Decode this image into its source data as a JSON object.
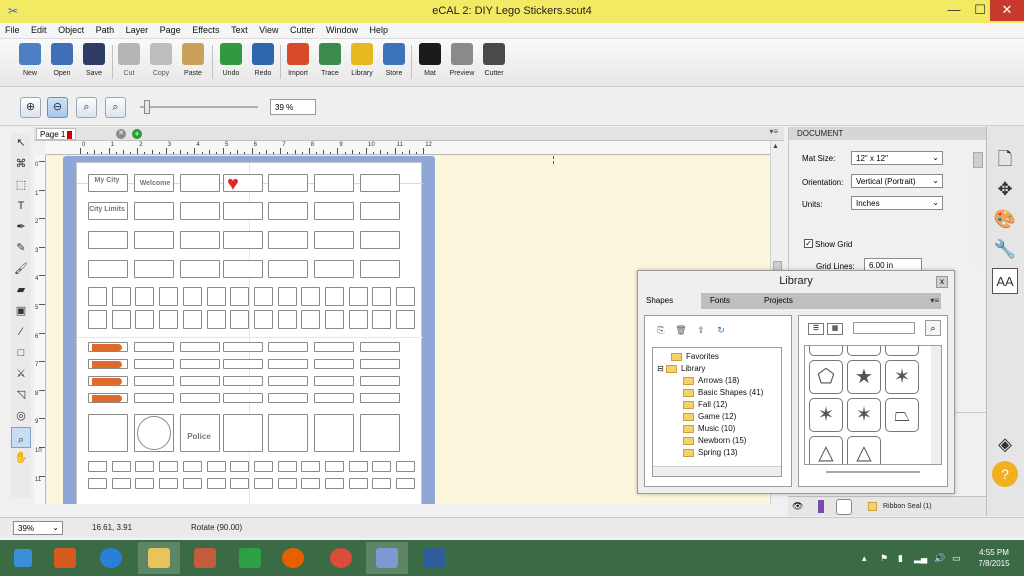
{
  "window": {
    "title": "eCAL 2: DIY Lego Stickers.scut4",
    "minimize": "—",
    "maximize": "☐",
    "close": "✕"
  },
  "menu": [
    "File",
    "Edit",
    "Object",
    "Path",
    "Layer",
    "Page",
    "Effects",
    "Text",
    "View",
    "Cutter",
    "Window",
    "Help"
  ],
  "toolbar": [
    {
      "label": "New",
      "icon": "new-document-icon",
      "color": "#4c7fc3"
    },
    {
      "label": "Open",
      "icon": "open-folder-icon",
      "color": "#3f6fb7"
    },
    {
      "label": "Save",
      "icon": "save-disk-icon",
      "color": "#2f3d66"
    },
    {
      "label": "Cut",
      "icon": "scissors-icon",
      "color": "#b5b5b5"
    },
    {
      "label": "Copy",
      "icon": "copy-icon",
      "color": "#bdbdbd"
    },
    {
      "label": "Paste",
      "icon": "paste-clipboard-icon",
      "color": "#c9a15a"
    },
    {
      "label": "Undo",
      "icon": "undo-arrow-icon",
      "color": "#2f9a3e"
    },
    {
      "label": "Redo",
      "icon": "redo-arrow-icon",
      "color": "#2f66b0"
    },
    {
      "label": "Import",
      "icon": "import-svg-icon",
      "color": "#d84b2a"
    },
    {
      "label": "Trace",
      "icon": "trace-image-icon",
      "color": "#3d8a4f"
    },
    {
      "label": "Library",
      "icon": "library-star-icon",
      "color": "#e6b91e"
    },
    {
      "label": "Store",
      "icon": "store-cart-icon",
      "color": "#3d73b8"
    },
    {
      "label": "Mat",
      "icon": "mat-arrows-icon",
      "color": "#1b1b1b"
    },
    {
      "label": "Preview",
      "icon": "preview-magnifier-icon",
      "color": "#8a8a8a"
    },
    {
      "label": "Cutter",
      "icon": "cutter-blade-icon",
      "color": "#4a4a4a"
    }
  ],
  "zoom": {
    "percent": "39 %",
    "slider_level_pct": 4
  },
  "tools": [
    "select-arrow-icon",
    "node-edit-icon",
    "shape-tool-icon",
    "text-tool-icon",
    "pen-tool-icon",
    "pencil-tool-icon",
    "brush-tool-icon",
    "eraser-tool-icon",
    "fill-tool-icon",
    "eyedropper-icon",
    "rectangle-tool-icon",
    "knife-tool-icon",
    "transform-tool-icon",
    "contour-tool-icon",
    "zoom-tool-icon",
    "ruler-tool-icon",
    "hand-pan-icon"
  ],
  "page_tab": {
    "label": "Page 1"
  },
  "ruler": {
    "h": [
      "0",
      "1",
      "2",
      "3",
      "4",
      "5",
      "6",
      "7",
      "8",
      "9",
      "10",
      "11",
      "12"
    ],
    "v": [
      "0",
      "1",
      "2",
      "3",
      "4",
      "5",
      "6",
      "7",
      "8",
      "9",
      "10",
      "11"
    ]
  },
  "canvas_text": {
    "my_city": "My City",
    "welcome": "Welcome",
    "city_limits": "City Limits",
    "police": "Police"
  },
  "document": {
    "header": "DOCUMENT",
    "mat_size_label": "Mat Size:",
    "mat_size": "12\" x 12\"",
    "orientation_label": "Orientation:",
    "orientation": "Vertical (Portrait)",
    "units_label": "Units:",
    "units": "Inches",
    "show_grid": "Show Grid",
    "show_grid_checked": "✓",
    "grid_lines_label": "Grid Lines:",
    "grid_lines": "6.00 in"
  },
  "library": {
    "title": "Library",
    "close": "x",
    "tabs": [
      "Shapes",
      "Fonts",
      "Projects"
    ],
    "tree": [
      "Favorites",
      "Library",
      "Arrows (18)",
      "Basic Shapes (41)",
      "Fall (12)",
      "Game (12)",
      "Music (10)",
      "Newborn (15)",
      "Spring (13)"
    ]
  },
  "layers": {
    "item_name": "Ribbon Seal (1)"
  },
  "status": {
    "zoom": "39%",
    "coords": "16.61, 3.91",
    "action": "Rotate (90.00)"
  },
  "taskbar": {
    "apps": [
      {
        "icon": "windows-start-icon",
        "color": "#3a8fd8"
      },
      {
        "icon": "media-center-icon",
        "color": "#d65a1f"
      },
      {
        "icon": "internet-explorer-icon",
        "color": "#2a7fd8"
      },
      {
        "icon": "file-explorer-icon",
        "color": "#e8c45a"
      },
      {
        "icon": "paint-app-icon",
        "color": "#c45b3a"
      },
      {
        "icon": "store-app-icon",
        "color": "#2ea043"
      },
      {
        "icon": "firefox-icon",
        "color": "#e66000"
      },
      {
        "icon": "chrome-icon",
        "color": "#dd4b39"
      },
      {
        "icon": "ecal-app-icon",
        "color": "#7b9ad4"
      },
      {
        "icon": "ecal-helper-icon",
        "color": "#2f5d9c"
      }
    ],
    "time": "4:55 PM",
    "date": "7/8/2015"
  }
}
